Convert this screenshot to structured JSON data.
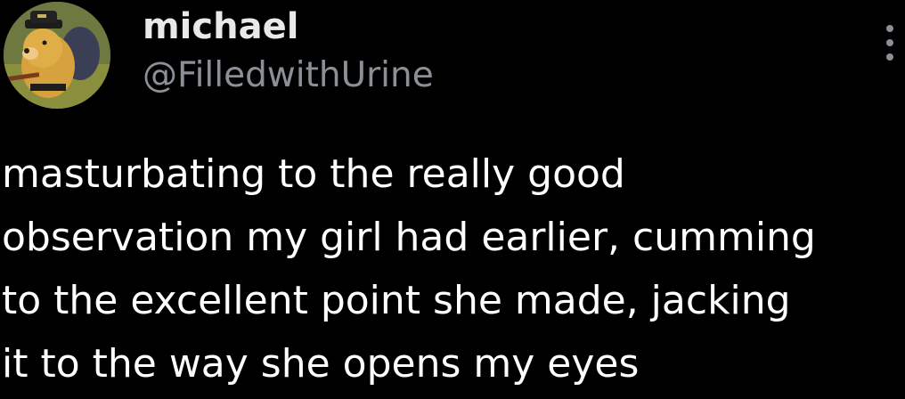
{
  "author": {
    "display_name": "michael",
    "handle": "@FilledwithUrine",
    "avatar_icon": "avatar-bear-with-hat"
  },
  "menu": {
    "icon": "more-vertical-icon"
  },
  "tweet": {
    "lines": [
      "masturbating to the really good",
      "observation my girl had earlier, cumming",
      "to the excellent point she made, jacking",
      "it to the way she opens my eyes"
    ]
  },
  "colors": {
    "background": "#000000",
    "name": "#e7e9ea",
    "handle": "#8b9097",
    "text": "#ffffff"
  }
}
